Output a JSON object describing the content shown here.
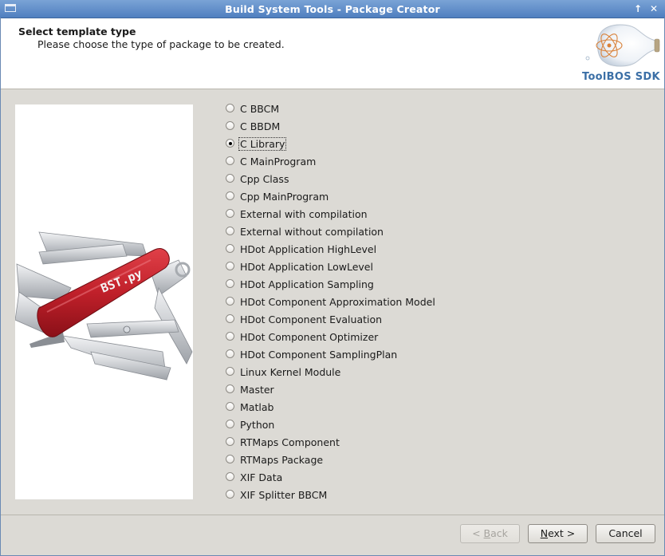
{
  "window": {
    "title": "Build System Tools - Package Creator",
    "controls": [
      "maximize-icon",
      "close-icon"
    ]
  },
  "header": {
    "title": "Select template type",
    "subtitle": "Please choose the type of package to be created.",
    "logo_text": "ToolBOS SDK"
  },
  "image_panel": {
    "engraving": "BST.py",
    "colors": {
      "knife_body": "#c0202a",
      "metal": "#c9ccd0"
    }
  },
  "template_options": {
    "selected": "C Library",
    "items": [
      "C BBCM",
      "C BBDM",
      "C Library",
      "C MainProgram",
      "Cpp Class",
      "Cpp MainProgram",
      "External with compilation",
      "External without compilation",
      "HDot Application HighLevel",
      "HDot Application LowLevel",
      "HDot Application Sampling",
      "HDot Component Approximation Model",
      "HDot Component Evaluation",
      "HDot Component Optimizer",
      "HDot Component SamplingPlan",
      "Linux Kernel Module",
      "Master",
      "Matlab",
      "Python",
      "RTMaps Component",
      "RTMaps Package",
      "XIF Data",
      "XIF Splitter BBCM"
    ]
  },
  "buttons": {
    "back": {
      "pre": "< ",
      "mnemonic": "B",
      "post": "ack",
      "enabled": false
    },
    "next": {
      "pre": "",
      "mnemonic": "N",
      "post": "ext >",
      "enabled": true
    },
    "cancel": {
      "label": "Cancel",
      "enabled": true
    }
  }
}
